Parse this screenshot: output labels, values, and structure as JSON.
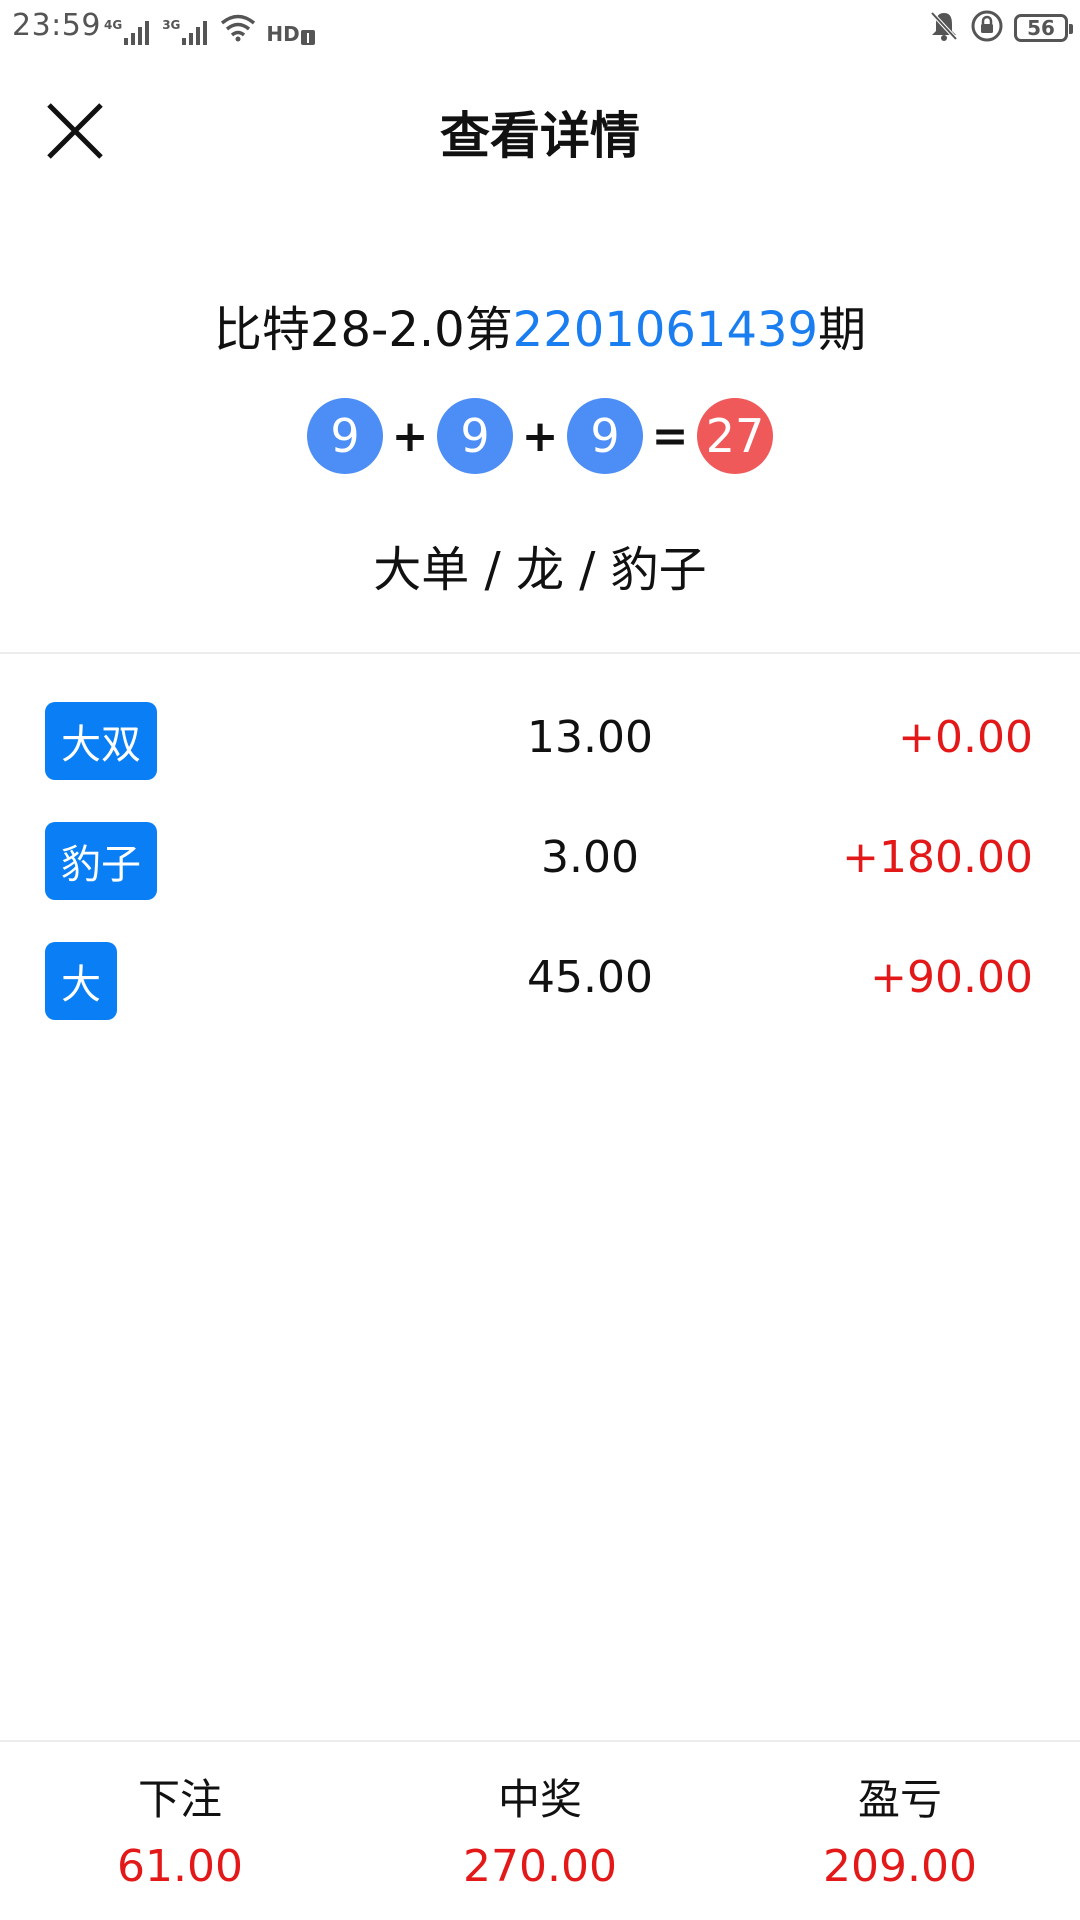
{
  "status_bar": {
    "time": "23:59",
    "network_1": "4G",
    "network_2": "3G",
    "hd_label": "HD",
    "battery": "56"
  },
  "header": {
    "title": "查看详情"
  },
  "period": {
    "prefix": "比特28-2.0第",
    "number": "2201061439",
    "suffix": "期"
  },
  "result": {
    "balls": [
      "9",
      "9",
      "9"
    ],
    "plus": "+",
    "equals": "=",
    "sum": "27",
    "description": "大单 / 龙 / 豹子"
  },
  "bets": [
    {
      "tag": "大双",
      "amount": "13.00",
      "result": "+0.00"
    },
    {
      "tag": "豹子",
      "amount": "3.00",
      "result": "+180.00"
    },
    {
      "tag": "大",
      "amount": "45.00",
      "result": "+90.00"
    }
  ],
  "footer": {
    "bet_label": "下注",
    "bet_value": "61.00",
    "win_label": "中奖",
    "win_value": "270.00",
    "profit_label": "盈亏",
    "profit_value": "209.00"
  },
  "colors": {
    "accent_blue": "#1a7ef0",
    "tag_blue": "#0a7ff5",
    "ball_blue": "#4c8ef5",
    "ball_red": "#f05959",
    "money_red": "#e31818"
  }
}
